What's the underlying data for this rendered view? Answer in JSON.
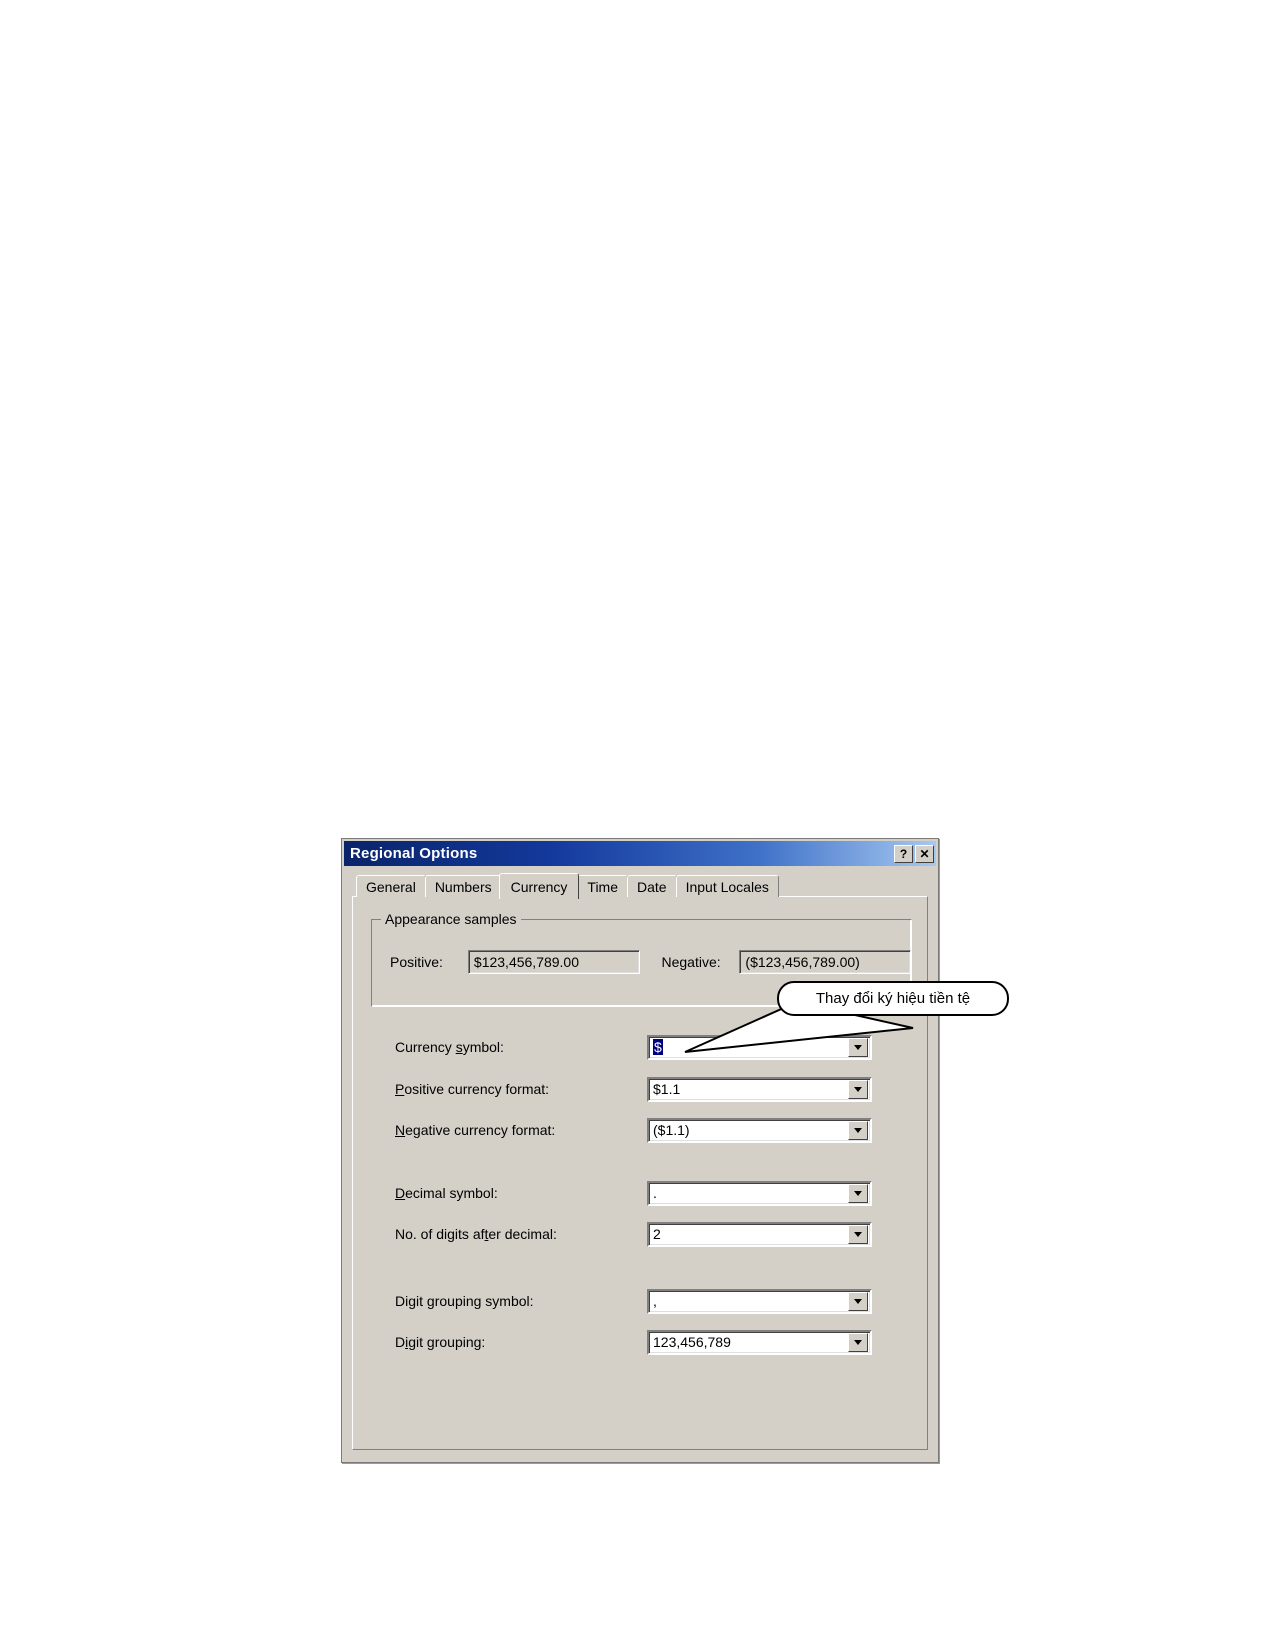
{
  "window": {
    "title": "Regional Options",
    "buttons": [
      {
        "name": "help-button",
        "label": "?"
      },
      {
        "name": "close-button",
        "label": "✕"
      }
    ]
  },
  "tabs": [
    {
      "label": "General",
      "selected": false
    },
    {
      "label": "Numbers",
      "selected": false
    },
    {
      "label": "Currency",
      "selected": true
    },
    {
      "label": "Time",
      "selected": false
    },
    {
      "label": "Date",
      "selected": false
    },
    {
      "label": "Input Locales",
      "selected": false
    }
  ],
  "appearance_samples": {
    "legend": "Appearance samples",
    "positive_label": "Positive:",
    "positive_value": "$123,456,789.00",
    "negative_label": "Negative:",
    "negative_value": "($123,456,789.00)"
  },
  "fields": {
    "currency_symbol": {
      "label_pre": "Currency ",
      "label_key": "s",
      "label_post": "ymbol:",
      "value": "$",
      "selected": true
    },
    "positive_currency_format": {
      "label_pre": "",
      "label_key": "P",
      "label_post": "ositive currency format:",
      "value": "$1.1",
      "selected": false
    },
    "negative_currency_format": {
      "label_pre": "",
      "label_key": "N",
      "label_post": "egative currency format:",
      "value": "($1.1)",
      "selected": false
    },
    "decimal_symbol": {
      "label_pre": "",
      "label_key": "D",
      "label_post": "ecimal symbol:",
      "value": ".",
      "selected": false
    },
    "digits_after_decimal": {
      "label_pre": "No. of digits af",
      "label_key": "t",
      "label_post": "er decimal:",
      "value": "2",
      "selected": false
    },
    "digit_grouping_symbol": {
      "label_pre": "Digit ",
      "label_key": "g",
      "label_post": "rouping symbol:",
      "value": ",",
      "selected": false
    },
    "digit_grouping": {
      "label_pre": "D",
      "label_key": "ig",
      "label_post": "it grouping:",
      "value": "123,456,789",
      "selected": false
    }
  },
  "callout": {
    "text": "Thay đổi ký hiệu tiền tệ"
  },
  "colors": {
    "dialog_face": "#d4d0c8",
    "title_gradient_start": "#0a246a",
    "title_gradient_end": "#a6c8f0",
    "selection_blue": "#000080",
    "field_white": "#ffffff"
  }
}
